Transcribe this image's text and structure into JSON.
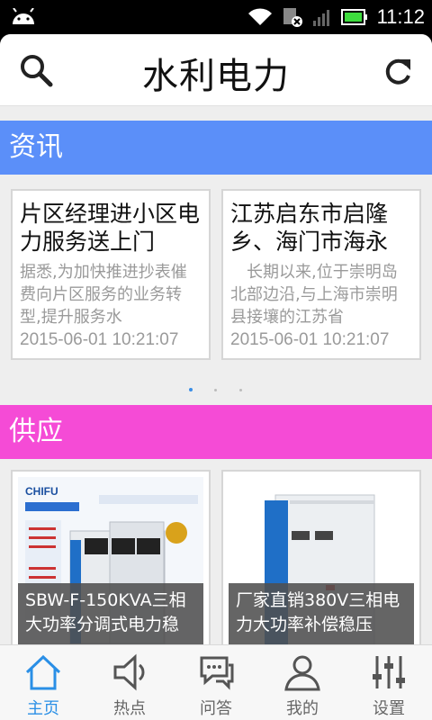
{
  "status_bar": {
    "time": "11:12"
  },
  "header": {
    "title": "水利电力"
  },
  "news_section": {
    "title": "资讯",
    "cards": [
      {
        "title": "片区经理进小区电力服务送上门",
        "summary": "据悉,为加快推进抄表催费向片区服务的业务转型,提升服务水",
        "date": "2015-06-01 10:21:07"
      },
      {
        "title": "江苏启东市启隆乡、海门市海永",
        "summary": "　长期以来,位于崇明岛北部边沿,与上海市崇明县接壤的江苏省",
        "date": "2015-06-01 10:21:07"
      }
    ],
    "pager": {
      "count": 3,
      "active": 1
    }
  },
  "supply_section": {
    "title": "供应",
    "products": [
      {
        "caption": "SBW-F-150KVA三相大功率分调式电力稳",
        "brand": "CHIFU"
      },
      {
        "caption": "厂家直销380V三相电力大功率补偿稳压"
      }
    ]
  },
  "bottom_nav": {
    "tabs": [
      {
        "label": "主页",
        "icon": "home-icon",
        "active": true
      },
      {
        "label": "热点",
        "icon": "speaker-icon",
        "active": false
      },
      {
        "label": "问答",
        "icon": "chat-bubbles-icon",
        "active": false
      },
      {
        "label": "我的",
        "icon": "user-icon",
        "active": false
      },
      {
        "label": "设置",
        "icon": "sliders-icon",
        "active": false
      }
    ]
  },
  "colors": {
    "news_bar": "#5b8ff9",
    "supply_bar": "#f54bd6",
    "active_tab": "#2a8fe6"
  }
}
